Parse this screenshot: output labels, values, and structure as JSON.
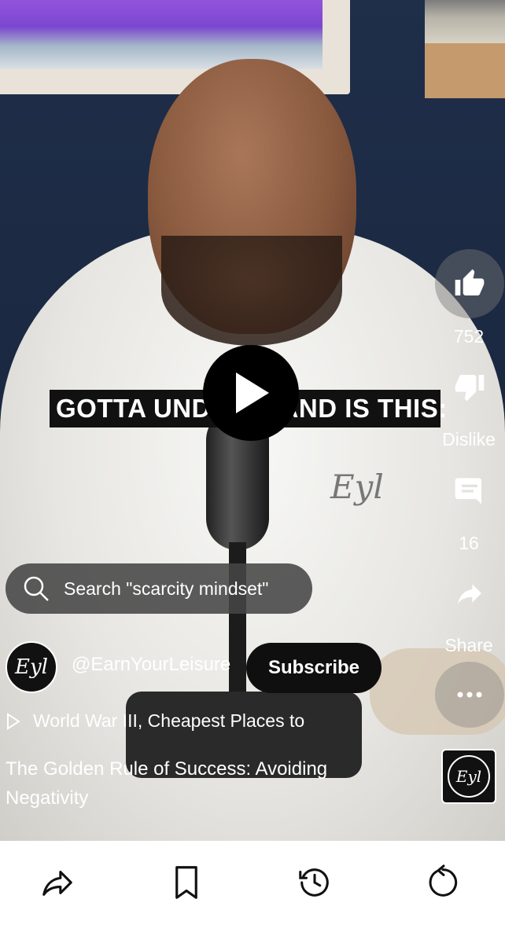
{
  "video": {
    "caption": "GOTTA UNDERSTAND IS THIS:"
  },
  "search_suggestion": {
    "text": "Search \"scarcity mindset\""
  },
  "channel": {
    "handle": "@EarnYourLeisure",
    "subscribe_label": "Subscribe",
    "avatar_text": "Eyl"
  },
  "playlist": {
    "text": "World War III, Cheapest Places to"
  },
  "short": {
    "title": "The Golden Rule of Success: Avoiding Negativity"
  },
  "actions": {
    "like_count": "752",
    "dislike_label": "Dislike",
    "comment_count": "16",
    "share_label": "Share"
  },
  "icons": {
    "like": "thumb-up-icon",
    "dislike": "thumb-down-icon",
    "comment": "comment-icon",
    "share": "share-icon",
    "more": "more-horizontal-icon",
    "search": "search-icon",
    "play": "play-icon",
    "playlist": "playlist-play-icon"
  },
  "bottom_nav": {
    "items": [
      "share-icon",
      "bookmark-icon",
      "history-icon",
      "replay-icon"
    ]
  },
  "colors": {
    "overlay_pill": "#464646",
    "subscribe_bg": "#0f0f0f",
    "text_light": "#ffffff"
  }
}
